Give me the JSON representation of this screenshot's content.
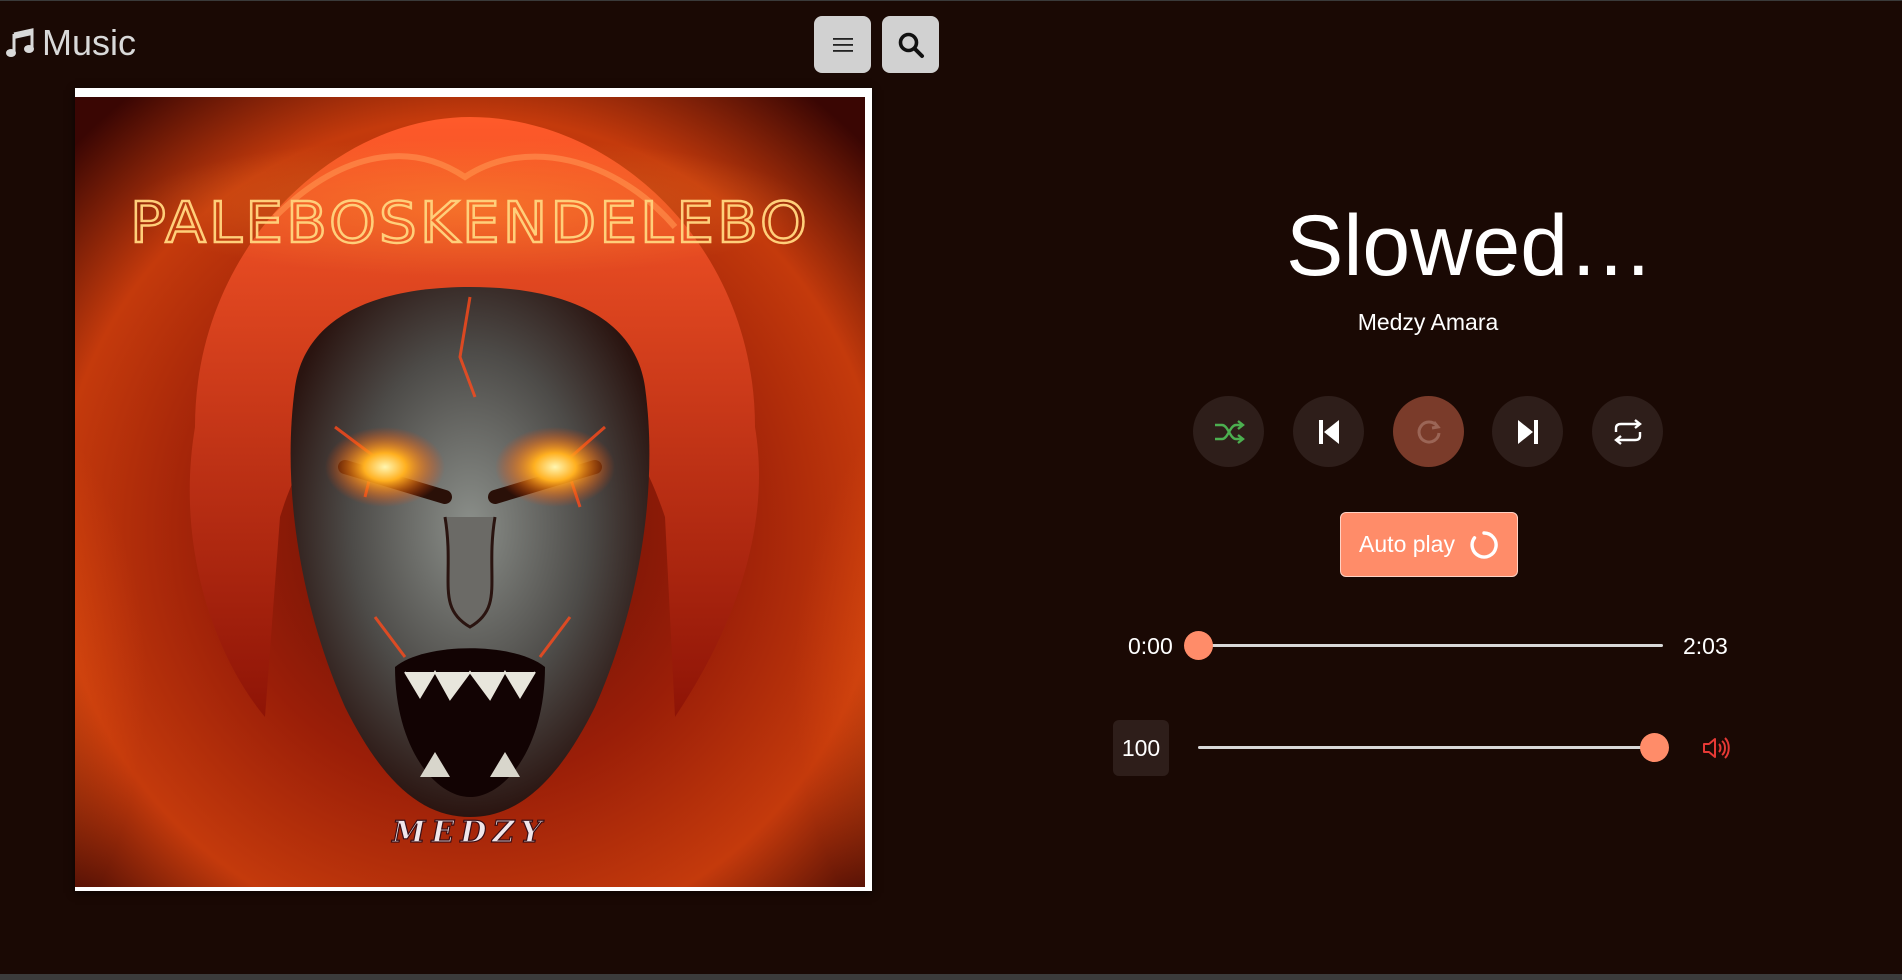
{
  "header": {
    "app_title": "Music",
    "icons": {
      "brand": "music-note-icon",
      "menu": "hamburger-menu-icon",
      "search": "search-icon"
    }
  },
  "cover": {
    "title_text": "PALEBOSKENDELEBO",
    "brand_text": "MEDZY"
  },
  "now_playing": {
    "title": "Slowed…",
    "artist": "Medzy Amara"
  },
  "controls": {
    "shuffle_icon": "shuffle-icon",
    "prev_icon": "skip-previous-icon",
    "play_icon": "loading-spinner-icon",
    "next_icon": "skip-next-icon",
    "repeat_icon": "repeat-icon"
  },
  "autoplay": {
    "label": "Auto play",
    "icon": "circle-spinner-icon"
  },
  "progress": {
    "current": "0:00",
    "duration": "2:03",
    "fraction": 0.0
  },
  "volume": {
    "value": "100",
    "fraction": 1.0,
    "icon": "speaker-volume-icon"
  },
  "colors": {
    "background": "#1a0904",
    "accent": "#ff8c69",
    "shuffle_active": "#4caf50",
    "volume_icon": "#e53935",
    "button_bg": "#2e1e1a"
  }
}
